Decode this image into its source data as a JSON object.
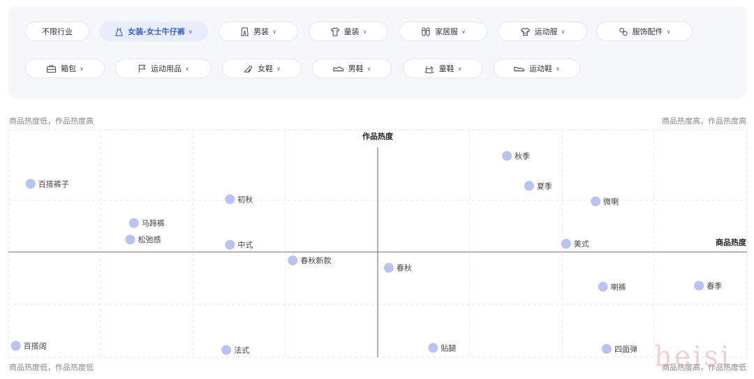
{
  "filters": {
    "row1": [
      {
        "label": "不限行业",
        "icon": "none",
        "active": false
      },
      {
        "label": "女装-女士牛仔裤",
        "icon": "dress-icon",
        "active": true
      },
      {
        "label": "男装",
        "icon": "pants-icon",
        "active": false
      },
      {
        "label": "童装",
        "icon": "tshirt-icon",
        "active": false
      },
      {
        "label": "家居服",
        "icon": "slippers-icon",
        "active": false
      },
      {
        "label": "运动服",
        "icon": "sportswear-icon",
        "active": false
      },
      {
        "label": "服饰配件",
        "icon": "accessory-icon",
        "active": false
      }
    ],
    "row2": [
      {
        "label": "箱包",
        "icon": "briefcase-icon",
        "active": false
      },
      {
        "label": "运动用品",
        "icon": "flag-icon",
        "active": false
      },
      {
        "label": "女鞋",
        "icon": "heel-icon",
        "active": false
      },
      {
        "label": "男鞋",
        "icon": "shoe-icon",
        "active": false
      },
      {
        "label": "童鞋",
        "icon": "rocking-horse-icon",
        "active": false
      },
      {
        "label": "运动鞋",
        "icon": "sneaker-icon",
        "active": false
      }
    ]
  },
  "quadrant_labels": {
    "top_left": "商品热度低，作品热度高",
    "top_right": "商品热度高，作品热度高",
    "bottom_left": "商品热度低，作品热度低",
    "bottom_right": "商品热度高，作品热度低"
  },
  "chart_data": {
    "type": "scatter",
    "xlabel": "商品热度",
    "ylabel": "作品热度",
    "xlim": [
      -100,
      100
    ],
    "ylim": [
      -100,
      100
    ],
    "grid": true,
    "points": [
      {
        "label": "秋季",
        "x": 35,
        "y": 93
      },
      {
        "label": "夏季",
        "x": 41,
        "y": 64
      },
      {
        "label": "微喇",
        "x": 59,
        "y": 49
      },
      {
        "label": "百搭裤子",
        "x": -94,
        "y": 66
      },
      {
        "label": "初秋",
        "x": -40,
        "y": 51
      },
      {
        "label": "马蹄裤",
        "x": -66,
        "y": 28
      },
      {
        "label": "松弛感",
        "x": -67,
        "y": 12
      },
      {
        "label": "中式",
        "x": -40,
        "y": 7
      },
      {
        "label": "美式",
        "x": 51,
        "y": 8
      },
      {
        "label": "春秋新款",
        "x": -23,
        "y": -8
      },
      {
        "label": "春秋",
        "x": 3,
        "y": -15
      },
      {
        "label": "喇裤",
        "x": 61,
        "y": -33
      },
      {
        "label": "春季",
        "x": 87,
        "y": -32
      },
      {
        "label": "百搭阔",
        "x": -98,
        "y": -89
      },
      {
        "label": "法式",
        "x": -41,
        "y": -93
      },
      {
        "label": "贴腿",
        "x": 15,
        "y": -91
      },
      {
        "label": "四面弹",
        "x": 62,
        "y": -92
      }
    ]
  },
  "colors": {
    "point": "#b7c3f3",
    "axis": "#888888",
    "grid": "#e2e4e8",
    "accent": "#3a5bd9"
  },
  "watermark": "heisi"
}
